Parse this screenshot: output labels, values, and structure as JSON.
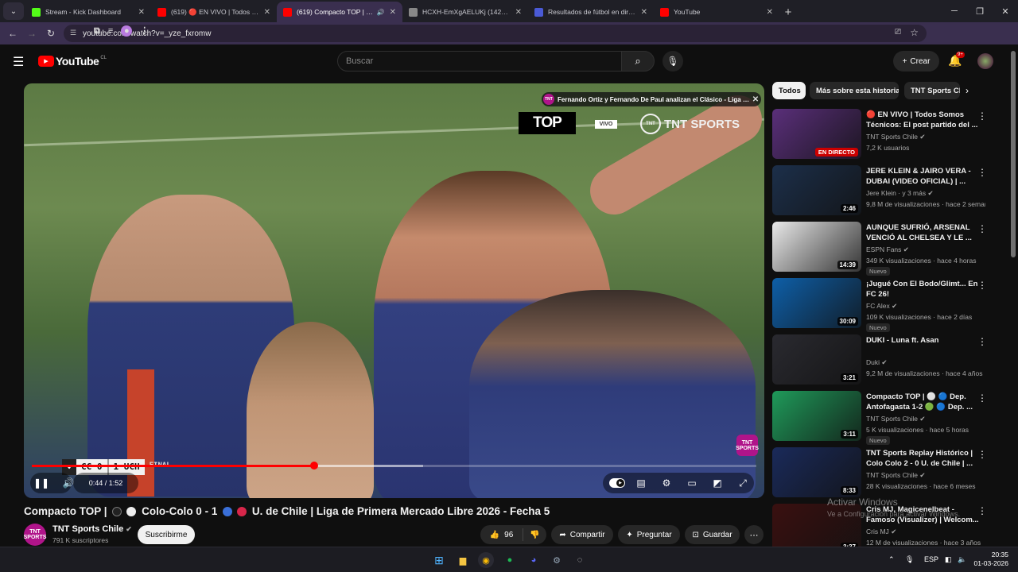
{
  "browser": {
    "tabs": [
      {
        "title": "Stream - Kick Dashboard",
        "color": "#53fc18",
        "active": false
      },
      {
        "title": "(619) 🔴 EN VIVO | Todos Somos",
        "color": "#ff0000",
        "active": false
      },
      {
        "title": "(619) Compacto TOP | ⚪ ⚪",
        "color": "#ff0000",
        "active": true
      },
      {
        "title": "HCXH-EmXgAELUKj (1429×1000)",
        "color": "#888888",
        "active": false
      },
      {
        "title": "Resultados de fútbol en directo",
        "color": "#4a5ad6",
        "active": false
      },
      {
        "title": "YouTube",
        "color": "#ff0000",
        "active": false
      }
    ],
    "url": "youtube.com/watch?v=_yze_fxromw"
  },
  "masthead": {
    "logo": "YouTube",
    "country": "CL",
    "search_placeholder": "Buscar",
    "create_label": "Crear",
    "notif_badge": "9+"
  },
  "player": {
    "overlay_title": "Fernando Ortiz y Fernando De Paul analizan el Clásico - Liga de ...",
    "top_label": "TOP",
    "vivo": "VIVO",
    "tnt_sports": "TNT SPORTS",
    "watermark": "TNT SPORTS",
    "score": {
      "home": "CC 0",
      "away": "1 UCH",
      "status": "FINAL"
    },
    "time": "0:44 / 1:52",
    "progress": 0.39,
    "buffered": 0.54
  },
  "video": {
    "title_parts": [
      "Compacto TOP |",
      "Colo-Colo 0 - 1",
      "U. de Chile | Liga de Primera Mercado Libre 2026 - Fecha 5"
    ],
    "channel": "TNT Sports Chile",
    "subscribers": "791 K suscriptores",
    "subscribe_label": "Suscribirme",
    "likes": "96",
    "share_label": "Compartir",
    "ask_label": "Preguntar",
    "save_label": "Guardar"
  },
  "chips": [
    "Todos",
    "Más sobre esta historia",
    "TNT Sports Chile"
  ],
  "recommendations": [
    {
      "title": "🔴 EN VIVO | Todos Somos Técnicos: El post partido del ...",
      "channel": "TNT Sports Chile",
      "meta": "7,2 K usuarios",
      "badge": "",
      "duration": "",
      "live": "EN DIRECTO",
      "thumb": "#5a2f7a"
    },
    {
      "title": "JERE KLEIN & JAIRO VERA - DUBAI (VIDEO OFICIAL) | ...",
      "channel": "Jere Klein · y 3 más",
      "meta": "9,8 M de visualizaciones · hace 2 seman...",
      "badge": "",
      "duration": "2:46",
      "live": "",
      "thumb": "#1c2f4a"
    },
    {
      "title": "AUNQUE SUFRIÓ, ARSENAL VENCIÓ AL CHELSEA Y LE ...",
      "channel": "ESPN Fans",
      "meta": "349 K visualizaciones · hace 4 horas",
      "badge": "Nuevo",
      "duration": "14:39",
      "live": "",
      "thumb": "#e9e9e9"
    },
    {
      "title": "¡Jugué Con El Bodo/Glimt... En FC 26!",
      "channel": "FC Alex",
      "meta": "109 K visualizaciones · hace 2 días",
      "badge": "Nuevo",
      "duration": "30:09",
      "live": "",
      "thumb": "#0e5fa8"
    },
    {
      "title": "DUKI - Luna ft. Asan",
      "channel": "Duki",
      "meta": "9,2 M de visualizaciones · hace 4 años",
      "badge": "",
      "duration": "3:21",
      "live": "",
      "thumb": "#2a2a30"
    },
    {
      "title": "Compacto TOP | ⚪ 🔵 Dep. Antofagasta 1-2 🟢 🔵 Dep. ...",
      "channel": "TNT Sports Chile",
      "meta": "5 K visualizaciones · hace 5 horas",
      "badge": "Nuevo",
      "duration": "3:11",
      "live": "",
      "thumb": "#1f9a5a"
    },
    {
      "title": "TNT Sports Replay Histórico | Colo Colo 2 - 0 U. de Chile | ...",
      "channel": "TNT Sports Chile",
      "meta": "28 K visualizaciones · hace 6 meses",
      "badge": "",
      "duration": "8:33",
      "live": "",
      "thumb": "#1a2a5a"
    },
    {
      "title": "Cris MJ, Magicenelbeat - Famoso (Visualizer) | Welcom...",
      "channel": "Cris MJ",
      "meta": "12 M de visualizaciones · hace 3 años",
      "badge": "",
      "duration": "3:37",
      "live": "",
      "thumb": "#3a1010"
    }
  ],
  "activate": {
    "line1": "Activar Windows",
    "line2": "Ve a Configuración para activar Windows."
  },
  "taskbar": {
    "lang": "ESP",
    "time": "20:35",
    "date": "01-03-2026"
  }
}
